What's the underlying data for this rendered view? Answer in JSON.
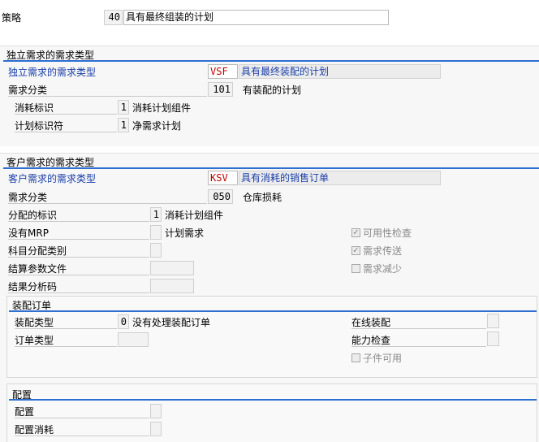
{
  "strategy": {
    "label": "策略",
    "code": "40",
    "desc": "具有最终组装的计划"
  },
  "independent": {
    "title": "独立需求的需求类型",
    "type_label": "独立需求的需求类型",
    "type_code": "VSF",
    "type_desc": "具有最终装配的计划",
    "class_label": "需求分类",
    "class_code": "101",
    "class_desc": "有装配的计划",
    "consumption_label": "消耗标识",
    "consumption_code": "1",
    "consumption_desc": "消耗计划组件",
    "planning_label": "计划标识符",
    "planning_code": "1",
    "planning_desc": "净需求计划"
  },
  "customer": {
    "title": "客户需求的需求类型",
    "type_label": "客户需求的需求类型",
    "type_code": "KSV",
    "type_desc": "具有消耗的销售订单",
    "class_label": "需求分类",
    "class_code": "050",
    "class_desc": "仓库损耗",
    "alloc_label": "分配的标识",
    "alloc_code": "1",
    "alloc_desc": "消耗计划组件",
    "nomrp_label": "没有MRP",
    "nomrp_desc": "计划需求",
    "acct_label": "科目分配类别",
    "settle_label": "结算参数文件",
    "result_label": "结果分析码",
    "check_availability": "可用性检查",
    "check_transfer": "需求传送",
    "check_reduce": "需求减少"
  },
  "assembly": {
    "title": "装配订单",
    "type_label": "装配类型",
    "type_code": "0",
    "type_desc": "没有处理装配订单",
    "order_type_label": "订单类型",
    "online_label": "在线装配",
    "capacity_label": "能力检查",
    "components_label": "子件可用"
  },
  "config": {
    "title": "配置",
    "config_label": "配置",
    "consumption_label": "配置消耗"
  }
}
